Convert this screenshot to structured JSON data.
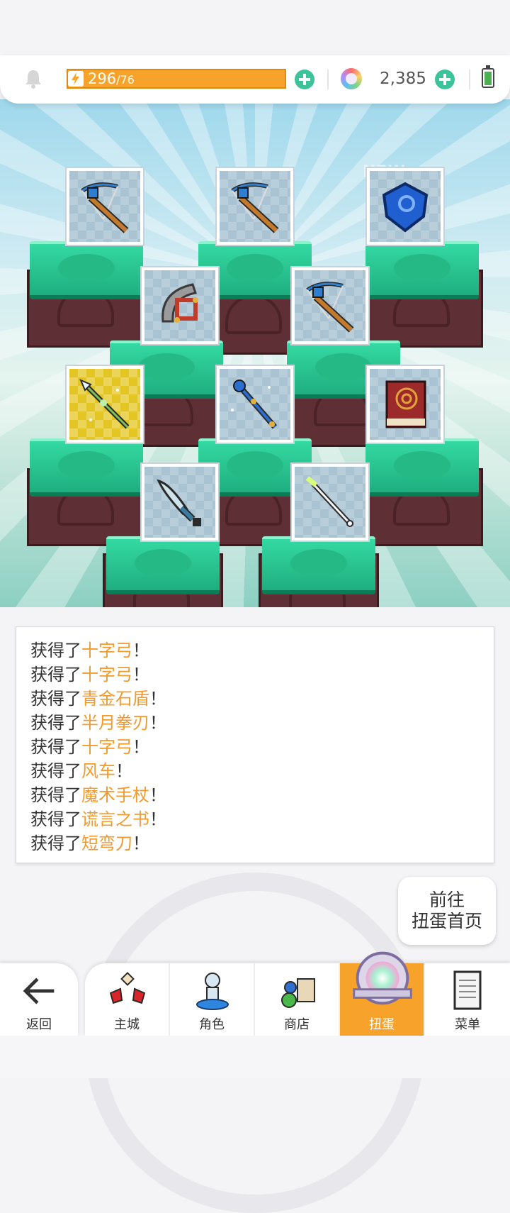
{
  "status_bar": {
    "energy_current": "296",
    "energy_max": "/76",
    "gem_count": "2,385",
    "battery_level": 0.9
  },
  "stage": {
    "new_badge": "NEW",
    "cards": [
      {
        "name": "crossbow",
        "rarity": "normal"
      },
      {
        "name": "crossbow",
        "rarity": "normal"
      },
      {
        "name": "shield",
        "rarity": "normal"
      },
      {
        "name": "half-moon-blade",
        "rarity": "normal"
      },
      {
        "name": "crossbow",
        "rarity": "normal"
      },
      {
        "name": "spear",
        "rarity": "gold"
      },
      {
        "name": "magic-staff",
        "rarity": "normal"
      },
      {
        "name": "book",
        "rarity": "normal"
      },
      {
        "name": "knife",
        "rarity": "normal"
      },
      {
        "name": "wand",
        "rarity": "normal"
      }
    ]
  },
  "log": {
    "prefix": "获得了",
    "suffix": "！",
    "entries": [
      "十字弓",
      "十字弓",
      "青金石盾",
      "半月拳刃",
      "十字弓",
      "风车",
      "魔术手杖",
      "谎言之书",
      "短弯刀"
    ]
  },
  "goto_button": {
    "line1": "前往",
    "line2": "扭蛋首页"
  },
  "nav": {
    "back_label": "返回",
    "items": [
      {
        "label": "主城",
        "icon": "town-icon"
      },
      {
        "label": "角色",
        "icon": "character-icon"
      },
      {
        "label": "商店",
        "icon": "shop-icon"
      },
      {
        "label": "扭蛋",
        "icon": "gacha-icon",
        "active": true
      },
      {
        "label": "菜单",
        "icon": "menu-icon"
      }
    ]
  },
  "colors": {
    "accent_orange": "#f7a22a",
    "item_text": "#f29a2e",
    "plus_green": "#3cc39a",
    "tile_green": "#21c28e"
  }
}
